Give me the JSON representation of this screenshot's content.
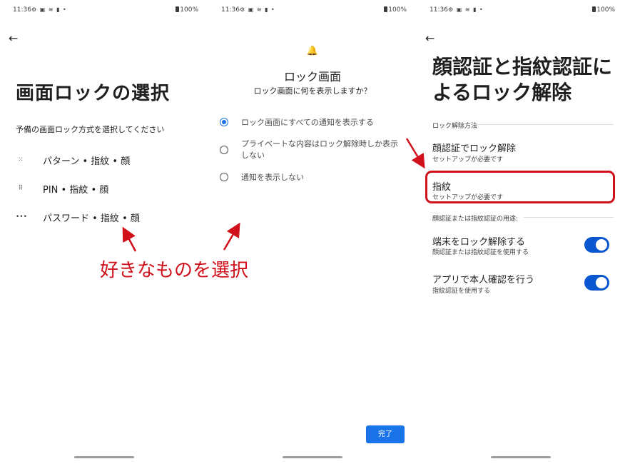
{
  "status_bar": {
    "time": "11:36",
    "icons": "⚙ ▣ ≋ ▮ •",
    "battery": "100%"
  },
  "screen1": {
    "title": "画面ロックの選択",
    "subtitle": "予備の画面ロック方式を選択してください",
    "options": [
      {
        "icon": "pattern-icon",
        "glyph": "⁙",
        "label": "パターン • 指紋 • 顔"
      },
      {
        "icon": "pin-icon",
        "glyph": "⠿",
        "label": "PIN • 指紋 • 顔"
      },
      {
        "icon": "password-icon",
        "glyph": "•••",
        "label": "パスワード • 指紋 • 顔"
      }
    ]
  },
  "screen2": {
    "bell_icon": "🔔",
    "title": "ロック画面",
    "subtitle": "ロック画面に何を表示しますか？",
    "options": [
      {
        "label": "ロック画面にすべての通知を表示する",
        "checked": true
      },
      {
        "label": "プライベートな内容はロック解除時しか表示しない",
        "checked": false
      },
      {
        "label": "通知を表示しない",
        "checked": false
      }
    ],
    "done_label": "完了"
  },
  "screen3": {
    "title": "顔認証と指紋認証によるロック解除",
    "section1": "ロック解除方法",
    "face_unlock": {
      "title": "顔認証でロック解除",
      "sub": "セットアップが必要です"
    },
    "fingerprint": {
      "title": "指紋",
      "sub": "セットアップが必要です"
    },
    "section2": "顔認証または指紋認証の用途:",
    "unlock_device": {
      "title": "端末をロック解除する",
      "sub": "顔認証または指紋認証を使用する",
      "on": true
    },
    "app_verify": {
      "title": "アプリで本人確認を行う",
      "sub": "指紋認証を使用する",
      "on": true
    }
  },
  "annotation": {
    "text": "好きなものを選択",
    "color": "#d0101a"
  },
  "colors": {
    "accent": "#1a73e8",
    "toggle": "#0b57d0",
    "annotation": "#d0101a"
  }
}
